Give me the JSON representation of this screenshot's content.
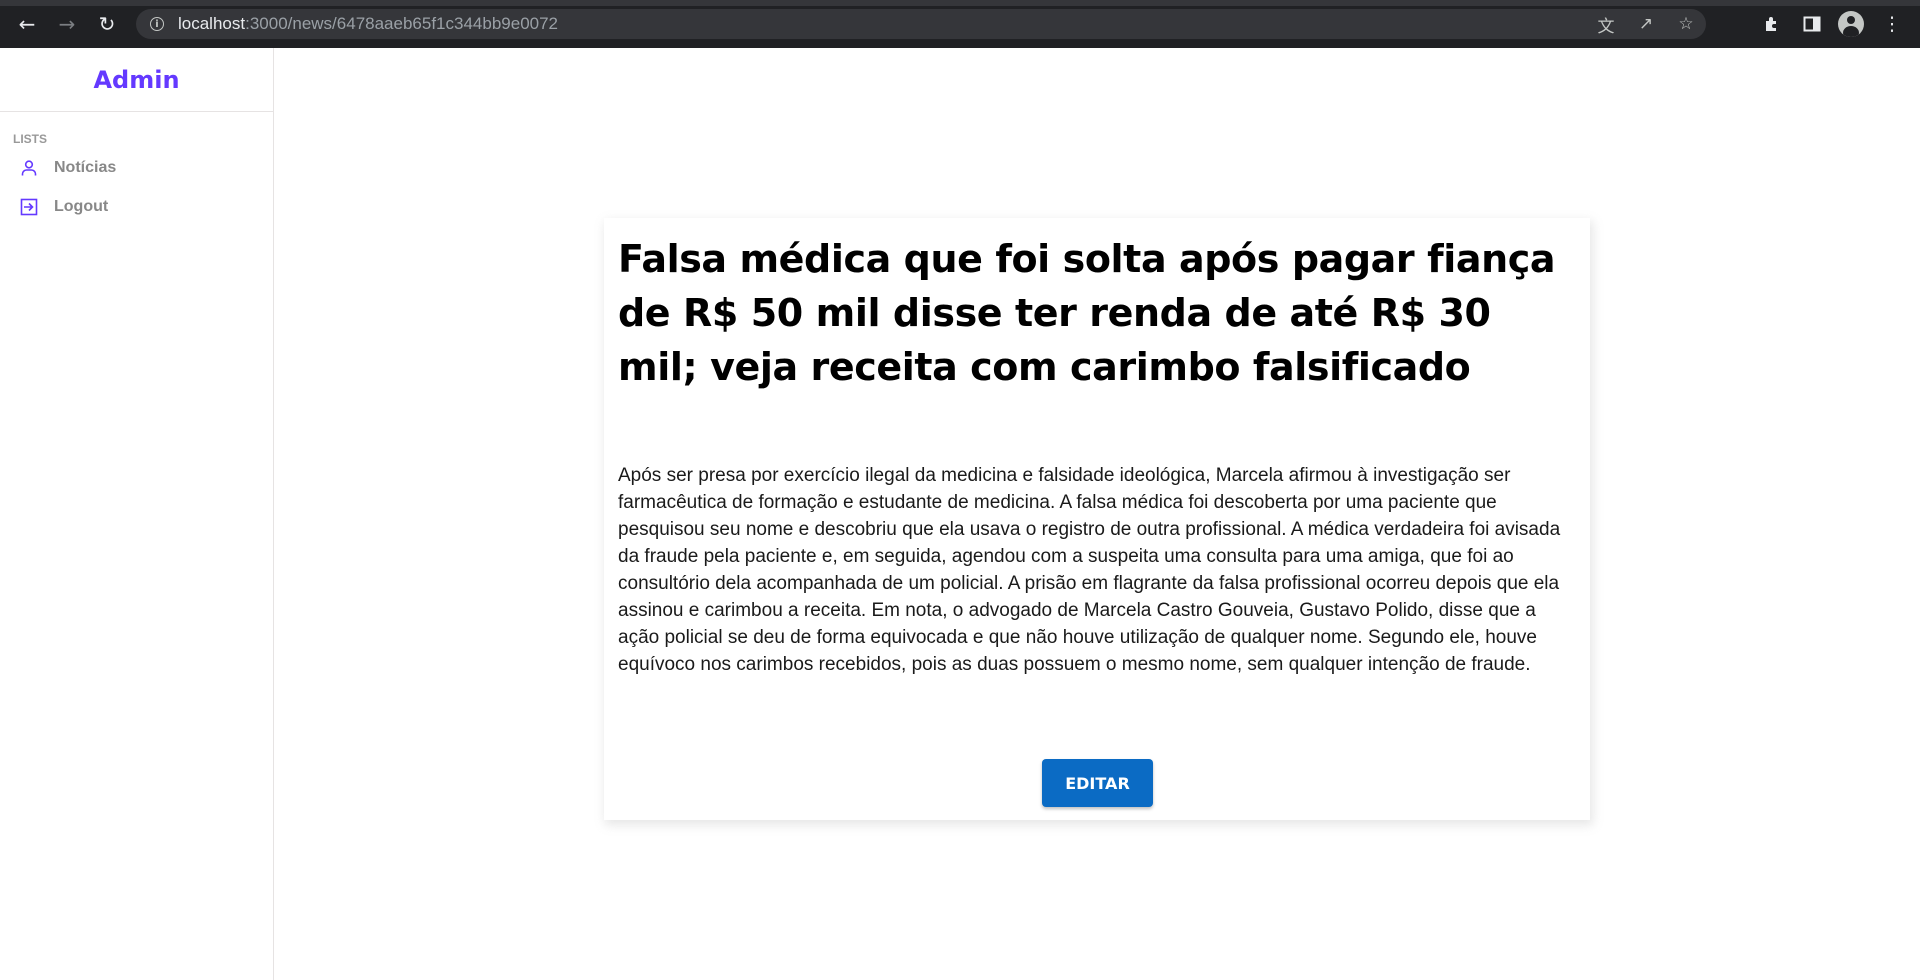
{
  "browser": {
    "url_host": "localhost",
    "url_path": ":3000/news/6478aaeb65f1c344bb9e0072",
    "icons": [
      "back-arrow-icon",
      "forward-arrow-icon",
      "reload-icon",
      "site-info-icon",
      "translate-icon",
      "share-icon",
      "bookmark-star-icon",
      "extensions-puzzle-icon",
      "side-panel-icon",
      "profile-avatar-icon",
      "more-menu-icon"
    ]
  },
  "sidebar": {
    "logo": "Admin",
    "section_title": "LISTS",
    "items": [
      {
        "label": "Notícias",
        "icon": "user-icon"
      },
      {
        "label": "Logout",
        "icon": "logout-icon"
      }
    ],
    "accent_color": "#6439ff"
  },
  "news": {
    "title": "Falsa médica que foi solta após pagar fiança de R$ 50 mil disse ter renda de até R$ 30 mil; veja receita com carimbo falsificado",
    "content": "Após ser presa por exercício ilegal da medicina e falsidade ideológica, Marcela afirmou à investigação ser farmacêutica de formação e estudante de medicina. A falsa médica foi descoberta por uma paciente que pesquisou seu nome e descobriu que ela usava o registro de outra profissional. A médica verdadeira foi avisada da fraude pela paciente e, em seguida, agendou com a suspeita uma consulta para uma amiga, que foi ao consultório dela acompanhada de um policial. A prisão em flagrante da falsa profissional ocorreu depois que ela assinou e carimbou a receita. Em nota, o advogado de Marcela Castro Gouveia, Gustavo Polido, disse que a ação policial se deu de forma equivocada e que não houve utilização de qualquer nome. Segundo ele, houve equívoco nos carimbos recebidos, pois as duas possuem o mesmo nome, sem qualquer intenção de fraude.",
    "edit_label": "EDITAR",
    "button_color": "#0b6bc4"
  }
}
